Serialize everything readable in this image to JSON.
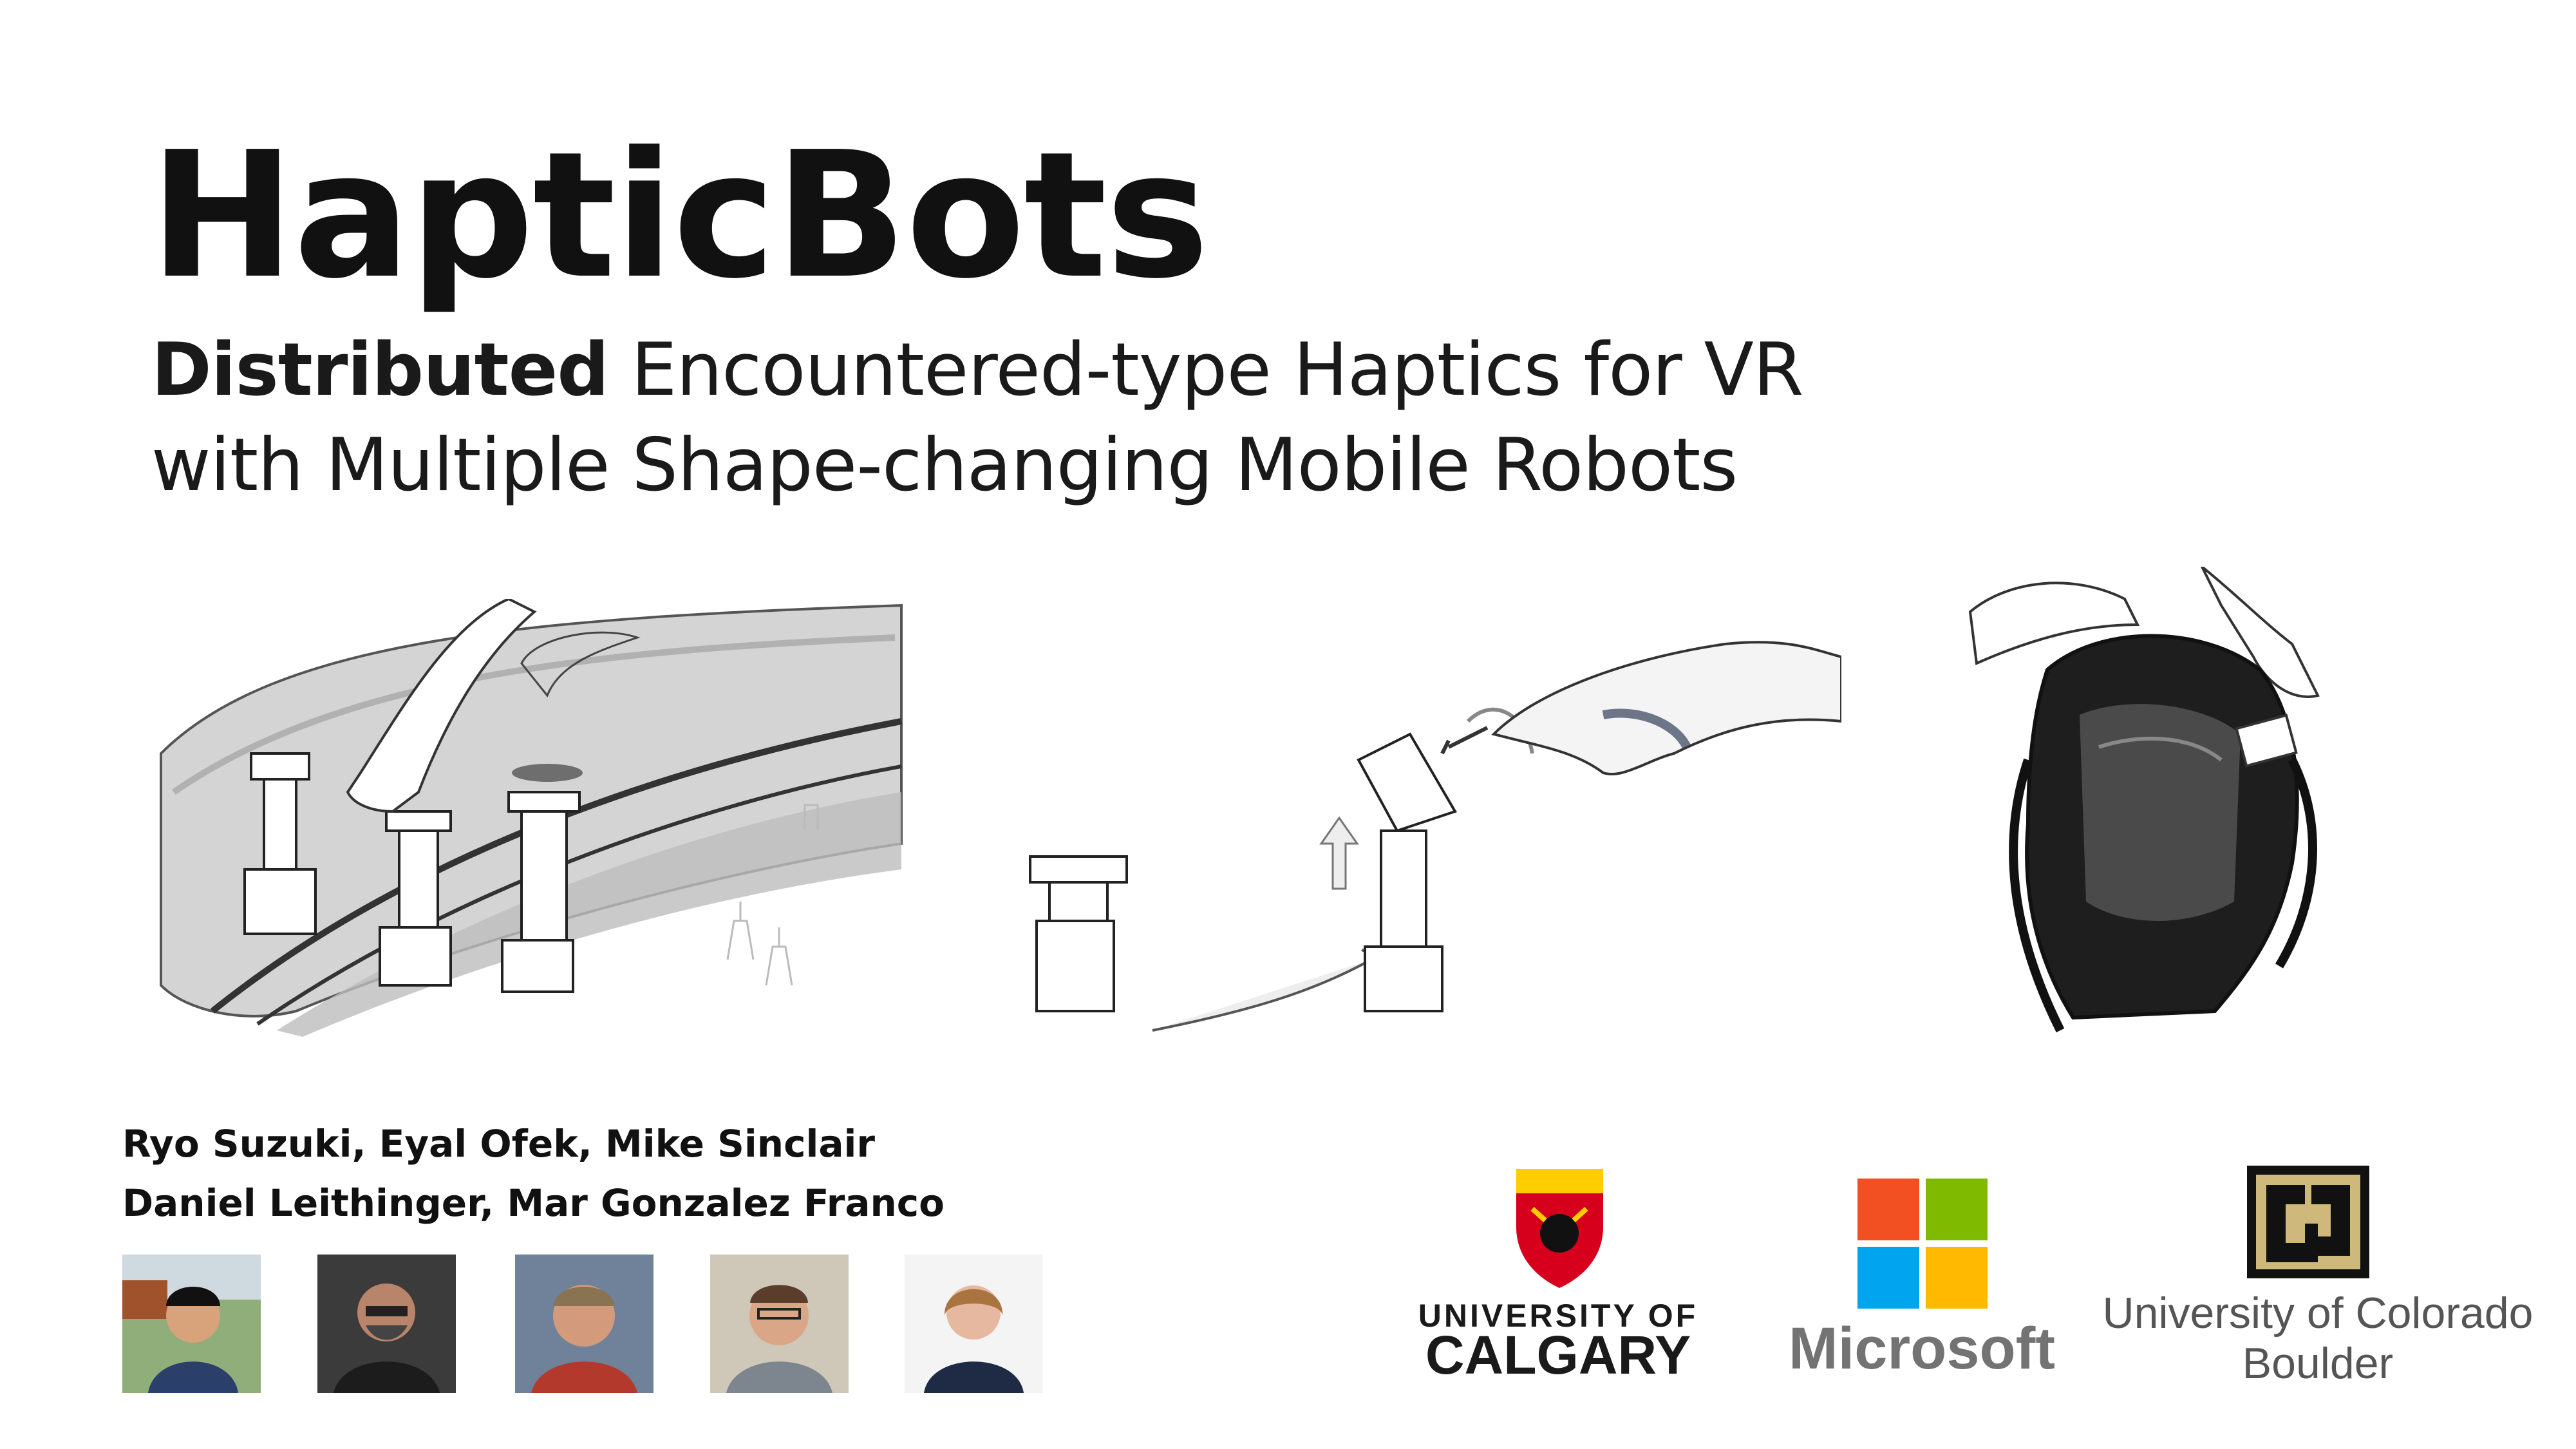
{
  "title": "HapticBots",
  "subtitle": {
    "bold": "Distributed",
    "line1_rest": " Encountered-type Haptics for VR",
    "line2": "with Multiple Shape-changing Mobile Robots"
  },
  "authors": {
    "line1": "Ryo Suzuki, Eyal Ofek, Mike Sinclair",
    "line2": "Daniel Leithinger, Mar Gonzalez Franco"
  },
  "photos": [
    {
      "name": "Ryo Suzuki",
      "bg": "#7fa06a"
    },
    {
      "name": "Eyal Ofek",
      "bg": "#3a3a3a"
    },
    {
      "name": "Mike Sinclair",
      "bg": "#6a7a8c"
    },
    {
      "name": "Daniel Leithinger",
      "bg": "#c9c3b6"
    },
    {
      "name": "Mar Gonzalez Franco",
      "bg": "#f2f2f2"
    }
  ],
  "logos": {
    "calgary": {
      "line1": "UNIVERSITY OF",
      "line2": "CALGARY",
      "red": "#d6001c",
      "gold": "#ffcd00"
    },
    "microsoft": {
      "text": "Microsoft",
      "colors": [
        "#f25022",
        "#7fba00",
        "#00a4ef",
        "#ffb900"
      ],
      "text_color": "#737373"
    },
    "colorado": {
      "line1": "University of Colorado",
      "line2": "Boulder",
      "gold": "#cfb87c"
    }
  }
}
